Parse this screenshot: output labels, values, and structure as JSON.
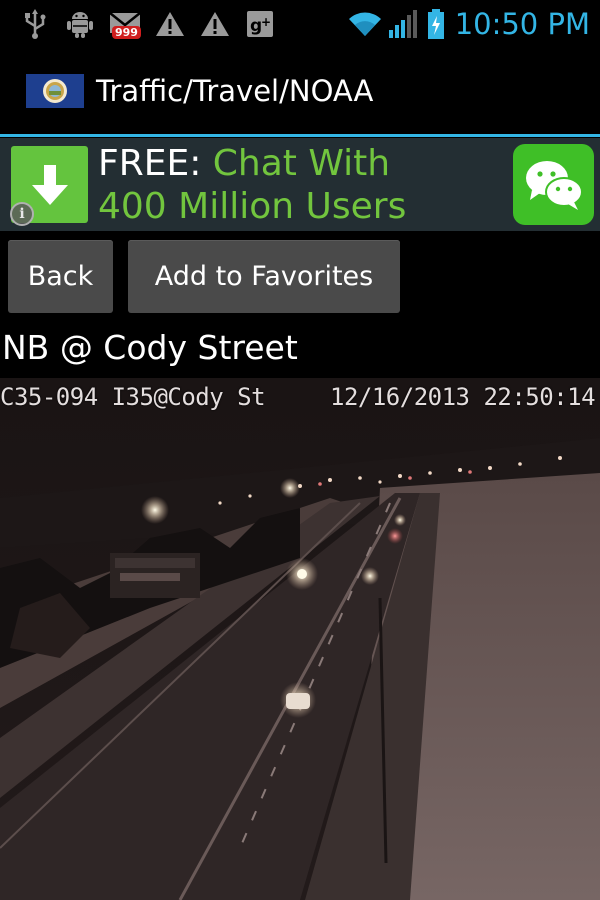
{
  "status_bar": {
    "notification_icons": [
      "usb-icon",
      "android-debug-icon",
      "gmail-icon",
      "warning-icon",
      "warning-icon",
      "google-plus-icon"
    ],
    "gmail_badge": "999",
    "clock": "10:50 PM",
    "accent_color": "#33b5e5"
  },
  "header": {
    "title": "Traffic/Travel/NOAA",
    "logo": "minnesota-flag-icon"
  },
  "ad": {
    "free_label": "FREE:",
    "line1": "Chat With",
    "line2": "400 Million Users",
    "info_symbol": "i",
    "app_icon": "wechat-icon",
    "accent_color": "#72c53e"
  },
  "buttons": {
    "back_label": "Back",
    "favorites_label": "Add to Favorites"
  },
  "camera": {
    "title": "NB @ Cody Street",
    "overlay_id": "C35-094 I35@Cody St",
    "overlay_timestamp": "12/16/2013 22:50:14"
  }
}
